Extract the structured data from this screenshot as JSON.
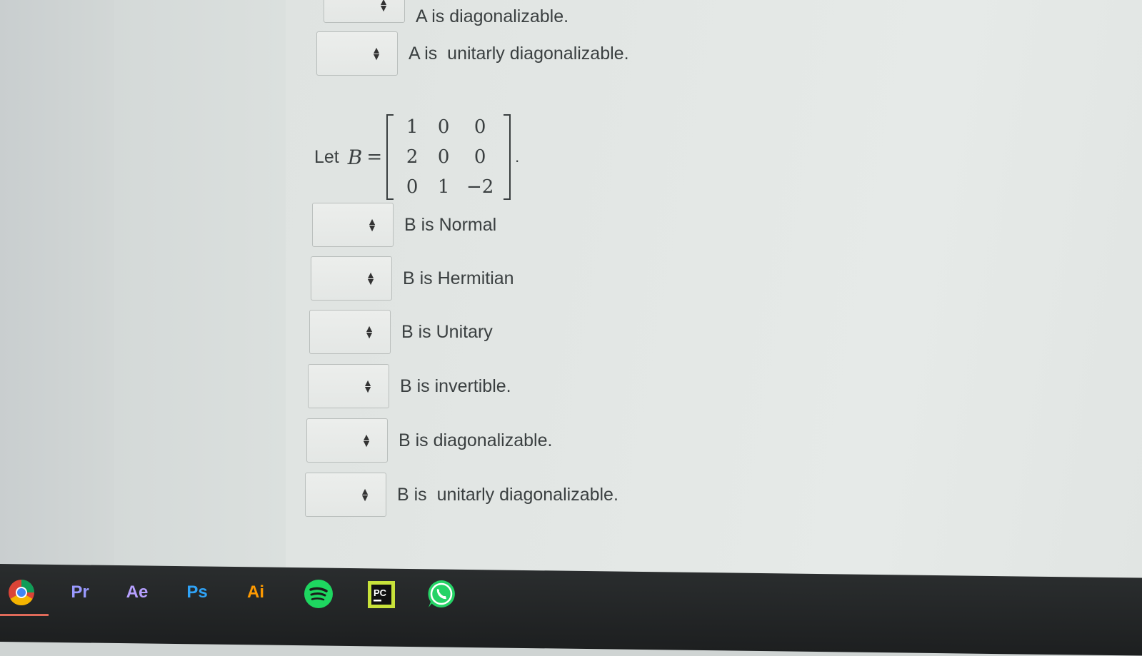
{
  "previous_section": {
    "partial_label": "A is diagonalizable.",
    "last_row": {
      "label": "A is  unitarly diagonalizable."
    }
  },
  "matrix_prompt": {
    "let_text": "Let",
    "variable": "B",
    "equals": "=",
    "rows": [
      [
        "1",
        "0",
        "0"
      ],
      [
        "2",
        "0",
        "0"
      ],
      [
        "0",
        "1",
        "−2"
      ]
    ],
    "terminator": "."
  },
  "statements": [
    {
      "label": "B is Normal",
      "value": ""
    },
    {
      "label": "B is Hermitian",
      "value": ""
    },
    {
      "label": "B is Unitary",
      "value": ""
    },
    {
      "label": "B is invertible.",
      "value": ""
    },
    {
      "label": "B is diagonalizable.",
      "value": ""
    },
    {
      "label": "B is  unitarly diagonalizable.",
      "value": ""
    }
  ],
  "taskbar": {
    "apps": [
      {
        "icon": "chrome-icon",
        "label": ""
      },
      {
        "icon": "premiere-pro-icon",
        "label": "Pr",
        "color": "#9a9aff"
      },
      {
        "icon": "after-effects-icon",
        "label": "Ae",
        "color": "#b7a0ff"
      },
      {
        "icon": "photoshop-icon",
        "label": "Ps",
        "color": "#2fa3f7"
      },
      {
        "icon": "illustrator-icon",
        "label": "Ai",
        "color": "#ff9a00"
      },
      {
        "icon": "spotify-icon",
        "label": "",
        "color": "#1ed760"
      },
      {
        "icon": "pycharm-icon",
        "label": "PC",
        "color": "#c8e23a"
      },
      {
        "icon": "whatsapp-icon",
        "label": "",
        "color": "#25d366"
      }
    ]
  }
}
